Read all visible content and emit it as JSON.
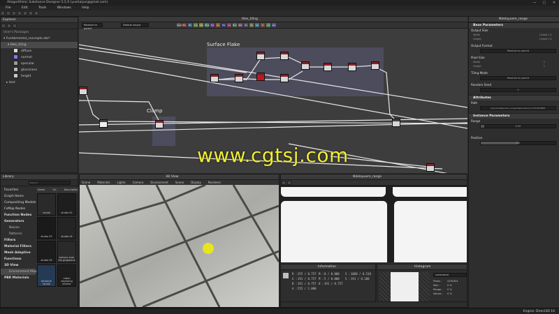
{
  "app": {
    "title": "Allegorithmic Substance Designer 5.5.0 (yuehaijun@gmail.com)",
    "window_controls": [
      "—",
      "▢",
      "✕"
    ]
  },
  "menu": [
    "File",
    "Edit",
    "Tools",
    "Windows",
    "Help"
  ],
  "explorer": {
    "title": "Explorer",
    "section": "User's Packages",
    "package": "Fundamental_concepts.sbs*",
    "graph": "tiles_tiling",
    "outputs": [
      {
        "label": "diffuse",
        "color": "#d9d9d9"
      },
      {
        "label": "normal",
        "color": "#7e7ef0"
      },
      {
        "label": "specular",
        "color": "#9a9a9a"
      },
      {
        "label": "glossiness",
        "color": "#b5b5b5"
      },
      {
        "label": "height",
        "color": "#c8c8c8"
      }
    ],
    "other": "text"
  },
  "graph": {
    "title": "tiles_tiling",
    "frames": {
      "surface_flake": "Surface Flake",
      "clamp": "Clamp"
    },
    "toolbar_fields": [
      "Relative to parent",
      "Default output"
    ],
    "chips": [
      "Seeds",
      "Bn",
      "Blr",
      "Crp",
      "Dst",
      "Emb",
      "Flp",
      "Gr",
      "HQ",
      "Lvl",
      "Nrm",
      "Rot",
      "Sh",
      "Sk",
      "Spl",
      "Tr",
      "Uni",
      "Vec"
    ]
  },
  "library": {
    "title": "Library",
    "search_placeholder": "Search",
    "columns": [
      "Name",
      "Url",
      "Description"
    ],
    "categories": [
      {
        "label": "Favorites",
        "bold": false,
        "sub": false,
        "hl": false
      },
      {
        "label": "Graph Items",
        "bold": false,
        "sub": false,
        "hl": false
      },
      {
        "label": "Compositing Models",
        "bold": false,
        "sub": false,
        "hl": false
      },
      {
        "label": "FxMap Nodes",
        "bold": false,
        "sub": false,
        "hl": false
      },
      {
        "label": "Function Nodes",
        "bold": true,
        "sub": false,
        "hl": false
      },
      {
        "label": "Generators",
        "bold": true,
        "sub": false,
        "hl": false
      },
      {
        "label": "Noises",
        "bold": false,
        "sub": true,
        "hl": false
      },
      {
        "label": "Patterns",
        "bold": false,
        "sub": true,
        "hl": false
      },
      {
        "label": "Filters",
        "bold": true,
        "sub": false,
        "hl": false
      },
      {
        "label": "Material Filters",
        "bold": true,
        "sub": false,
        "hl": false
      },
      {
        "label": "Mesh Adaptive",
        "bold": true,
        "sub": false,
        "hl": false
      },
      {
        "label": "Functions",
        "bold": true,
        "sub": false,
        "hl": false
      },
      {
        "label": "3D View",
        "bold": true,
        "sub": false,
        "hl": false
      },
      {
        "label": "Environment Maps",
        "bold": false,
        "sub": true,
        "hl": true
      },
      {
        "label": "PBR Materials",
        "bold": true,
        "sub": false,
        "hl": false
      }
    ],
    "thumbs": [
      "studio",
      "studio 02",
      "studio 03",
      "studio 04",
      "studio 05",
      "tomoco over the grapevine",
      "bitmerie studio",
      "urban exploring interior"
    ]
  },
  "view3d": {
    "title": "3D View",
    "menus": [
      "Scene",
      "Materials",
      "Lights",
      "Camera",
      "Environment",
      "Scene",
      "Display",
      "Renderer"
    ]
  },
  "view2d": {
    "title": "Ndelayuem_range",
    "zoom": "1%"
  },
  "info": {
    "title": "Information",
    "rows": [
      [
        "R :",
        "255 / 0.757",
        "M :",
        "0 / 0.000",
        "S :",
        "1060 / 0.518"
      ],
      [
        "G :",
        "191 / 0.757",
        "M :",
        "5 / 0.000",
        "S :",
        "191 / 0.100"
      ],
      [
        "B :",
        "191 / 0.757",
        "H :",
        "191 / 0.757",
        "",
        ""
      ],
      [
        "A :",
        "255 / 1.000",
        "",
        "",
        "",
        ""
      ]
    ]
  },
  "histogram": {
    "title": "Histogram",
    "channel": "Luminance",
    "stats": [
      {
        "label": "Pixels :",
        "value": "4194304"
      },
      {
        "label": "Max :",
        "value": "0 %"
      },
      {
        "label": "Range :",
        "value": "0 %"
      },
      {
        "label": "Values :",
        "value": "0 %"
      }
    ]
  },
  "params": {
    "title": "Ndelayuem_range",
    "sections": {
      "base": "Base Parameters",
      "attributes": "Attributes",
      "instance": "Instance Parameters"
    },
    "output_size": {
      "label": "Output Size",
      "width": "Width",
      "height": "Height",
      "width_val": "Linked 1:1",
      "height_val": "Linked 1:1"
    },
    "output_format": {
      "label": "Output Format",
      "value": "Relative to parent"
    },
    "pixel_size": {
      "label": "Pixel Size",
      "width": "Width",
      "height": "Height",
      "w_val": "1",
      "h_val": "1"
    },
    "tiling_mode": {
      "label": "Tiling Mode",
      "value": "Relative to parent"
    },
    "random_seed": {
      "label": "Random Seed",
      "value": "0"
    },
    "path": {
      "label": "Path",
      "value": "pkg:///ndelayuem_range?dependency=1251839861"
    },
    "range": {
      "label": "Range",
      "value": "0.05"
    },
    "position": {
      "label": "Position",
      "value": "0.5"
    }
  },
  "status": {
    "engine": "Engine: Direct3D 10"
  },
  "watermark": "www.cgtsj.com"
}
